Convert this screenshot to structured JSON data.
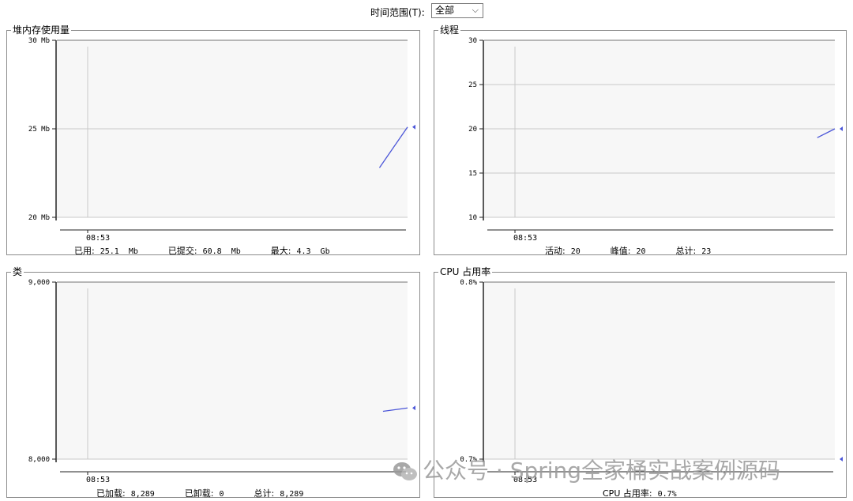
{
  "toolbar": {
    "time_range_label": "时间范围(T):",
    "time_range_value": "全部"
  },
  "panels": {
    "heap": {
      "title": "堆内存使用量",
      "series_label": "已用",
      "series_value": "25,088,664",
      "footer": [
        {
          "label": "已用:",
          "value": "25.1  Mb"
        },
        {
          "label": "已提交:",
          "value": "60.8  Mb"
        },
        {
          "label": "最大:",
          "value": "4.3  Gb"
        }
      ]
    },
    "threads": {
      "title": "线程",
      "series_label": "活动线程",
      "series_value": "20",
      "footer": [
        {
          "label": "活动:",
          "value": "20"
        },
        {
          "label": "峰值:",
          "value": "20"
        },
        {
          "label": "总计:",
          "value": "23"
        }
      ]
    },
    "classes": {
      "title": "类",
      "series_label": "已加载",
      "series_value": "8,289",
      "footer": [
        {
          "label": "已加载:",
          "value": "8,289"
        },
        {
          "label": "已卸载:",
          "value": "0"
        },
        {
          "label": "总计:",
          "value": "8,289"
        }
      ]
    },
    "cpu": {
      "title": "CPU 占用率",
      "series_label": "CPU 占用率",
      "series_value": "0.7%",
      "footer": [
        {
          "label": "CPU 占用率:",
          "value": "0.7%"
        }
      ]
    }
  },
  "watermark": "公众号 · Spring全家桶实战案例源码",
  "colors": {
    "series": "#4a55d8",
    "grid": "#c8c8c8",
    "plot_bg": "#f7f7f7",
    "watermark": "#9a9a9a"
  },
  "chart_data": [
    {
      "type": "line",
      "title": "堆内存使用量",
      "y_ticks": [
        "30 Mb",
        "25 Mb",
        "20 Mb"
      ],
      "ylim": [
        20,
        30
      ],
      "x_ticks": [
        "08:53"
      ],
      "series": [
        {
          "name": "已用",
          "values": [
            22.8,
            25.1
          ]
        }
      ]
    },
    {
      "type": "line",
      "title": "线程",
      "y_ticks": [
        "30",
        "25",
        "20",
        "15",
        "10"
      ],
      "ylim": [
        10,
        30
      ],
      "x_ticks": [
        "08:53"
      ],
      "series": [
        {
          "name": "活动线程",
          "values": [
            19,
            20
          ]
        }
      ]
    },
    {
      "type": "line",
      "title": "类",
      "y_ticks": [
        "9,000",
        "8,000"
      ],
      "ylim": [
        8000,
        9000
      ],
      "x_ticks": [
        "08:53"
      ],
      "series": [
        {
          "name": "已加载",
          "values": [
            8270,
            8289
          ]
        }
      ]
    },
    {
      "type": "line",
      "title": "CPU 占用率",
      "y_ticks": [
        "0.8%",
        "0.7%"
      ],
      "ylim": [
        0.7,
        0.8
      ],
      "x_ticks": [
        "08:53"
      ],
      "series": [
        {
          "name": "CPU 占用率",
          "values": [
            0.7
          ]
        }
      ]
    }
  ]
}
